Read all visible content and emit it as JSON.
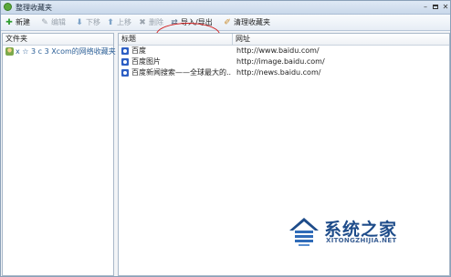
{
  "window": {
    "title": "整理收藏夹",
    "minimize_glyph": "–",
    "close_glyph": "✕"
  },
  "toolbar": {
    "new_label": "新建",
    "edit_label": "编辑",
    "down_label": "下移",
    "up_label": "上移",
    "delete_label": "删除",
    "import_export_label": "导入/导出",
    "clean_label": "清理收藏夹"
  },
  "left_pane": {
    "header": "文件夹",
    "items": [
      {
        "label": "x ☆ 3 c 3 Xcom的网络收藏夹"
      }
    ]
  },
  "right_pane": {
    "columns": [
      "标题",
      "网址"
    ],
    "rows": [
      {
        "title": "百度",
        "url": "http://www.baidu.com/"
      },
      {
        "title": "百度图片",
        "url": "http://image.baidu.com/"
      },
      {
        "title": "百度新闻搜索——全球最大的...",
        "url": "http://news.baidu.com/"
      }
    ]
  },
  "watermark": {
    "name": "系统之家",
    "url": "XITONGZHIJIA.NET"
  },
  "colors": {
    "accent_red_highlight": "#d21f1f",
    "watermark_blue": "#1e4c8a",
    "link_blue": "#2a5e96"
  }
}
